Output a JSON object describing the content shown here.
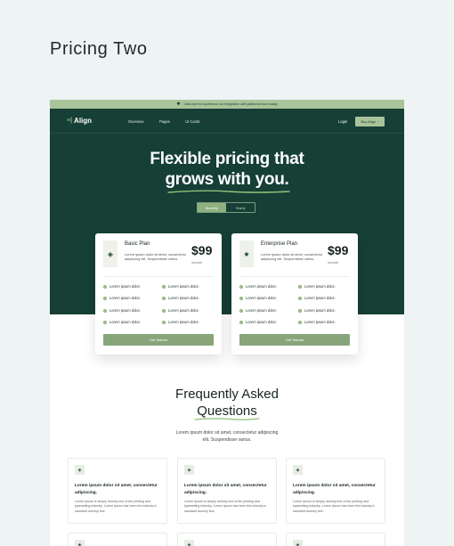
{
  "page_title": "Pricing Two",
  "announcement": {
    "text": "Click here to experience our integration with platforms more easily"
  },
  "nav": {
    "brand": "Align",
    "links": [
      "Overview",
      "Pages",
      "UI Cards"
    ],
    "login": "Login",
    "buy": "Buy Align",
    "buy_arrow": "›"
  },
  "hero": {
    "line1": "Flexible pricing that",
    "line2": "grows with you."
  },
  "billing_toggle": {
    "monthly": "Monthly",
    "yearly": "Yearly"
  },
  "plans": [
    {
      "name": "Basic Plan",
      "description": "Lorem ipsum dolor sit amet, consectetur adipiscing elit. Suspendisse varius.",
      "price": "$99",
      "period": "/month",
      "icon": "layers-icon",
      "features": [
        "Lorem ipsum dolor.",
        "Lorem ipsum dolor.",
        "Lorem ipsum dolor.",
        "Lorem ipsum dolor.",
        "Lorem ipsum dolor.",
        "Lorem ipsum dolor.",
        "Lorem ipsum dolor.",
        "Lorem ipsum dolor."
      ],
      "cta": "Get Started"
    },
    {
      "name": "Enterprise Plan",
      "description": "Lorem ipsum dolor sit amet, consectetur adipiscing elit. Suspendisse varius.",
      "price": "$99",
      "period": "/month",
      "icon": "star-icon",
      "features": [
        "Lorem ipsum dolor.",
        "Lorem ipsum dolor.",
        "Lorem ipsum dolor.",
        "Lorem ipsum dolor.",
        "Lorem ipsum dolor.",
        "Lorem ipsum dolor.",
        "Lorem ipsum dolor.",
        "Lorem ipsum dolor."
      ],
      "cta": "Get Started"
    }
  ],
  "faq": {
    "title_line1": "Frequently Asked",
    "title_line2": "Questions",
    "subtitle": "Lorem ipsum dolor sit amet, consectetur adipiscing elit. Suspendisse varius.",
    "items": [
      {
        "question": "Lorem ipsum dolor sit amet, consectetur adipiscing.",
        "answer": "Lorem Ipsum is simply dummy text of the printing and typesetting industry. Lorem Ipsum has been the industry's standard dummy text."
      },
      {
        "question": "Lorem ipsum dolor sit amet, consectetur adipiscing.",
        "answer": "Lorem Ipsum is simply dummy text of the printing and typesetting industry. Lorem Ipsum has been the industry's standard dummy text."
      },
      {
        "question": "Lorem ipsum dolor sit amet, consectetur adipiscing.",
        "answer": "Lorem Ipsum is simply dummy text of the printing and typesetting industry. Lorem Ipsum has been the industry's standard dummy text."
      }
    ]
  },
  "colors": {
    "brand_dark": "#163f36",
    "accent_green": "#8fb07f",
    "announcement_bg": "#a9c49a",
    "page_bg": "#eef3f4"
  }
}
